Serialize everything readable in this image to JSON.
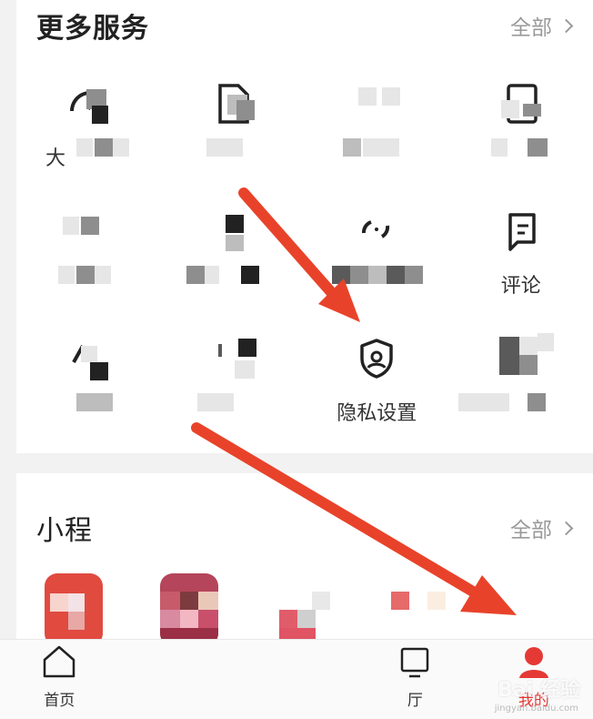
{
  "services": {
    "title": "更多服务",
    "more_label": "全部",
    "items": [
      {
        "label": "大",
        "icon": "speedometer-icon"
      },
      {
        "label": "",
        "icon": "document-icon"
      },
      {
        "label": "",
        "icon": "grid-icon"
      },
      {
        "label": "",
        "icon": "tablet-icon"
      },
      {
        "label": "",
        "icon": "list-icon"
      },
      {
        "label": "",
        "icon": "tag-icon"
      },
      {
        "label": "",
        "icon": "refresh-icon"
      },
      {
        "label": "评论",
        "icon": "comment-icon"
      },
      {
        "label": "",
        "icon": "pen-icon"
      },
      {
        "label": "",
        "icon": "box-icon"
      },
      {
        "label": "隐私设置",
        "icon": "privacy-shield-icon"
      },
      {
        "label": "",
        "icon": "blocks-icon"
      }
    ]
  },
  "mini_programs": {
    "title": "小程",
    "more_label": "全部"
  },
  "tabbar": {
    "items": [
      {
        "label": "首页",
        "icon": "home-icon"
      },
      {
        "label": "",
        "icon": "blank-icon"
      },
      {
        "label": "",
        "icon": "blank-icon"
      },
      {
        "label": "厅",
        "icon": "screen-icon"
      },
      {
        "label": "我的",
        "icon": "profile-icon"
      }
    ]
  },
  "watermark": {
    "text": "Bai 经验",
    "sub": "jingyan.baidu.com"
  },
  "colors": {
    "accent": "#e53935",
    "arrow": "#e8432a"
  }
}
